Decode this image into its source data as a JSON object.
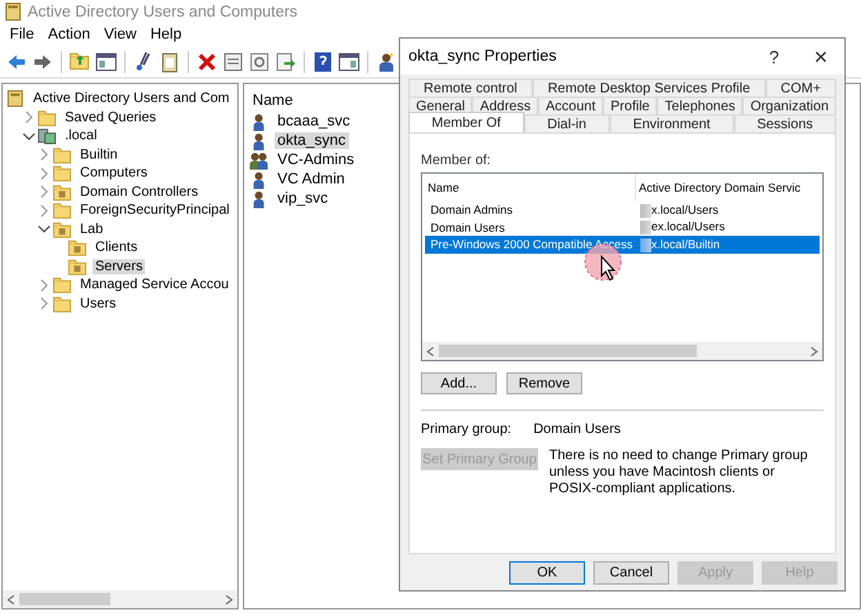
{
  "window": {
    "title": "Active Directory Users and Computers"
  },
  "menu": [
    "File",
    "Action",
    "View",
    "Help"
  ],
  "tree": {
    "label": "Active Directory Users and Com",
    "kind": "console",
    "children": [
      {
        "label": "Saved Queries",
        "kind": "folder",
        "expanded": false
      },
      {
        "label": ".local",
        "kind": "domain",
        "expanded": true,
        "children": [
          {
            "label": "Builtin",
            "kind": "folder",
            "expanded": false
          },
          {
            "label": "Computers",
            "kind": "folder",
            "expanded": false
          },
          {
            "label": "Domain Controllers",
            "kind": "ou",
            "expanded": false
          },
          {
            "label": "ForeignSecurityPrincipal",
            "kind": "folder",
            "expanded": false
          },
          {
            "label": "Lab",
            "kind": "ou",
            "expanded": true,
            "children": [
              {
                "label": "Clients",
                "kind": "ou",
                "selected": false
              },
              {
                "label": "Servers",
                "kind": "ou",
                "selected": true
              }
            ]
          },
          {
            "label": "Managed Service Accou",
            "kind": "folder",
            "expanded": false
          },
          {
            "label": "Users",
            "kind": "folder",
            "expanded": false
          }
        ]
      }
    ]
  },
  "list": {
    "column": "Name",
    "items": [
      {
        "name": "bcaaa_svc",
        "kind": "user",
        "selected": false
      },
      {
        "name": "okta_sync",
        "kind": "user",
        "selected": true
      },
      {
        "name": "VC-Admins",
        "kind": "group",
        "selected": false
      },
      {
        "name": "VC Admin",
        "kind": "user",
        "selected": false
      },
      {
        "name": "vip_svc",
        "kind": "user",
        "selected": false
      }
    ]
  },
  "dialog": {
    "title": "okta_sync Properties",
    "help": "?",
    "close": "✕",
    "tab_rows": [
      [
        {
          "label": "Remote control",
          "selected": false
        },
        {
          "label": "Remote Desktop Services Profile",
          "selected": false
        },
        {
          "label": "COM+",
          "selected": false
        }
      ],
      [
        {
          "label": "General",
          "selected": false
        },
        {
          "label": "Address",
          "selected": false
        },
        {
          "label": "Account",
          "selected": false
        },
        {
          "label": "Profile",
          "selected": false
        },
        {
          "label": "Telephones",
          "selected": false
        },
        {
          "label": "Organization",
          "selected": false
        }
      ],
      [
        {
          "label": "Member Of",
          "selected": true
        },
        {
          "label": "Dial-in",
          "selected": false
        },
        {
          "label": "Environment",
          "selected": false
        },
        {
          "label": "Sessions",
          "selected": false
        }
      ]
    ],
    "member_of_label": "Member of:",
    "table": {
      "columns": [
        "Name",
        "Active Directory Domain Servic"
      ],
      "rows": [
        {
          "name": "Domain Admins",
          "folder": "x.local/Users",
          "selected": false
        },
        {
          "name": "Domain Users",
          "folder": "ex.local/Users",
          "selected": false
        },
        {
          "name": "Pre-Windows 2000 Compatible Access",
          "folder": "x.local/Builtin",
          "selected": true
        }
      ]
    },
    "add_button": "Add...",
    "remove_button": "Remove",
    "primary_group_label": "Primary group:",
    "primary_group_value": "Domain Users",
    "set_primary_button": {
      "label": "Set Primary Group",
      "disabled": true
    },
    "note": "There is no need to change Primary group unless you have Macintosh clients or POSIX-compliant applications.",
    "buttons": [
      {
        "label": "OK",
        "default": true,
        "disabled": false
      },
      {
        "label": "Cancel",
        "default": false,
        "disabled": false
      },
      {
        "label": "Apply",
        "default": false,
        "disabled": true
      },
      {
        "label": "Help",
        "default": false,
        "disabled": true
      }
    ]
  }
}
